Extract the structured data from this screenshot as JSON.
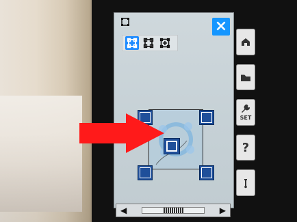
{
  "screen": {
    "close_label": "×",
    "modes": [
      {
        "name": "frame-mode-1",
        "active": true
      },
      {
        "name": "frame-mode-2",
        "active": false
      },
      {
        "name": "frame-mode-3",
        "active": false
      }
    ]
  },
  "side_panel": {
    "set_label": "SET",
    "help_label": "?"
  },
  "colors": {
    "accent": "#1596ff",
    "handle": "#1f4f9a",
    "arrow": "#ff1a1a"
  },
  "icons": {
    "top_left": "frame-icon",
    "home": "home-icon",
    "folder": "folder-icon",
    "settings": "wrench-icon",
    "help": "help-icon",
    "needle": "needle-icon",
    "left": "left-arrow-icon",
    "right": "right-arrow-icon"
  }
}
